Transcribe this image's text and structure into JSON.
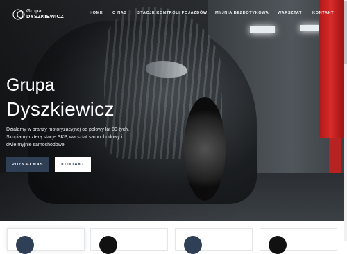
{
  "brand": {
    "line1": "Grupa",
    "line2": "DYSZKIEWICZ"
  },
  "nav": {
    "items": [
      {
        "label": "HOME"
      },
      {
        "label": "O NAS"
      },
      {
        "label": "STACJE KONTROLI POJAZDÓW"
      },
      {
        "label": "MYJNIA BEZDOTYKOWA"
      },
      {
        "label": "WARSZTAT"
      },
      {
        "label": "KONTAKT"
      }
    ]
  },
  "hero": {
    "title_line1": "Grupa",
    "title_line2": "Dyszkiewicz",
    "description": "Działamy w branży motoryzacyjnej od połowy lat 80-tych. Skupiamy czterą stacje SKP, warsztat samochodowy i dwie myjnie samochodowe.",
    "primary_button": "POZNAJ NAS",
    "secondary_button": "KONTAKT"
  },
  "colors": {
    "accent": "#2f3f55",
    "red": "#c41f1f"
  },
  "cards": [
    {
      "icon": "service-icon",
      "color": "#2f3f55"
    },
    {
      "icon": "car-icon",
      "color": "#111111"
    },
    {
      "icon": "wrench-icon",
      "color": "#2f3f55"
    },
    {
      "icon": "carwash-icon",
      "color": "#111111"
    }
  ]
}
